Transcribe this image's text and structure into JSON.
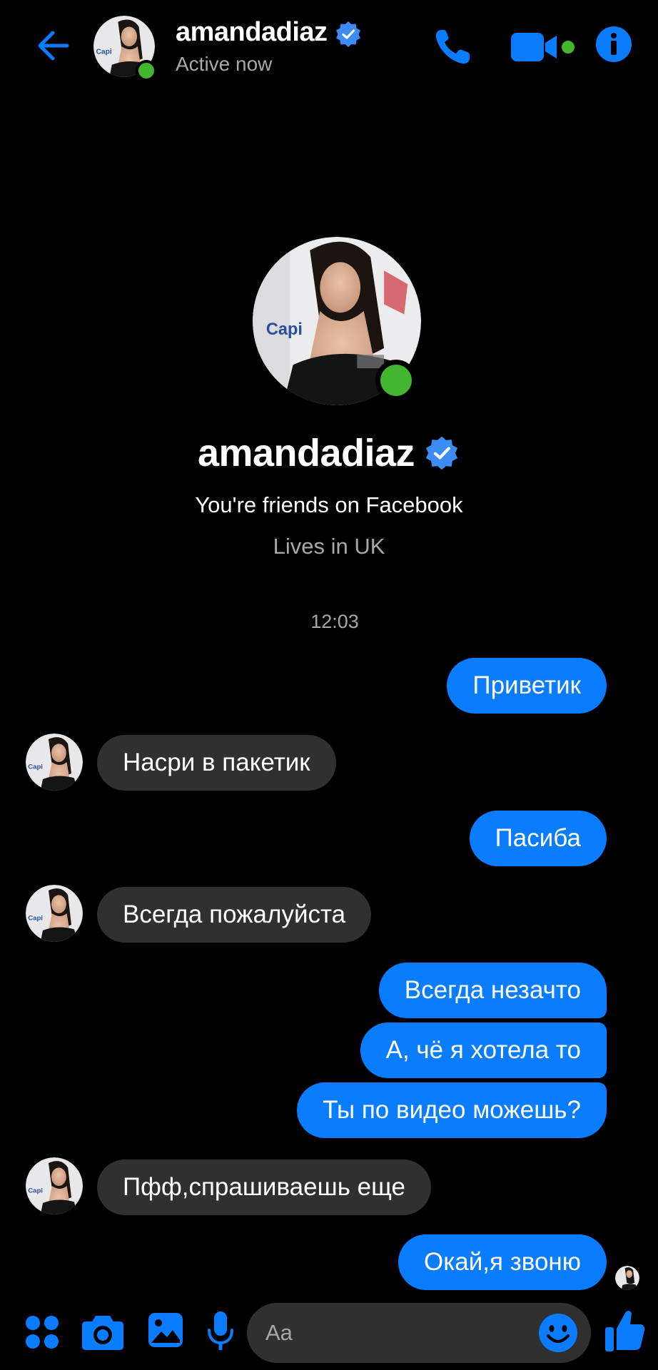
{
  "header": {
    "name": "amandadiaz",
    "status": "Active now"
  },
  "profile": {
    "name": "amandadiaz",
    "friends_text": "You're friends on Facebook",
    "lives_text": "Lives in UK"
  },
  "timestamp": "12:03",
  "messages": [
    {
      "from": "me",
      "text": "Приветик"
    },
    {
      "from": "them",
      "text": "Насри в пакетик"
    },
    {
      "from": "me",
      "text": "Пасиба"
    },
    {
      "from": "them",
      "text": "Всегда пожалуйста"
    },
    {
      "from": "me",
      "text": "Всегда незачто"
    },
    {
      "from": "me",
      "text": "А, чё я хотела то"
    },
    {
      "from": "me",
      "text": "Ты по видео можешь?"
    },
    {
      "from": "them",
      "text": "Пфф,спрашиваешь еще"
    },
    {
      "from": "me",
      "text": "Окай,я звоню"
    }
  ],
  "composer": {
    "placeholder": "Aa"
  },
  "colors": {
    "accent": "#0a7cff",
    "incoming_bubble": "#303030",
    "online": "#43b62f",
    "background": "#000000"
  },
  "icons": [
    "back-arrow-icon",
    "phone-icon",
    "video-camera-icon",
    "info-icon",
    "apps-grid-icon",
    "camera-icon",
    "gallery-icon",
    "microphone-icon",
    "emoji-icon",
    "thumbs-up-icon",
    "verified-badge-icon"
  ]
}
